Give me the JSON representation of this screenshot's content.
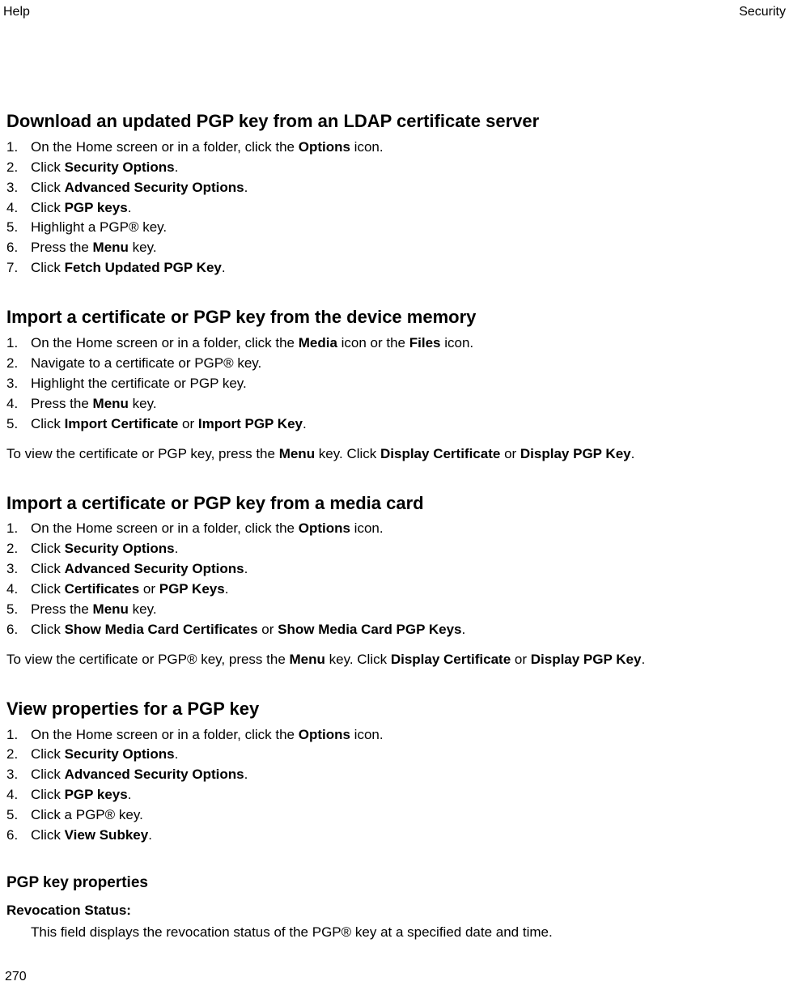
{
  "header": {
    "left": "Help",
    "right": "Security"
  },
  "pageNumber": "270",
  "sections": [
    {
      "heading": "Download an updated PGP key from an LDAP certificate server",
      "steps": [
        [
          {
            "t": "On the Home screen or in a folder, click the "
          },
          {
            "t": "Options",
            "b": true
          },
          {
            "t": " icon."
          }
        ],
        [
          {
            "t": "Click "
          },
          {
            "t": "Security Options",
            "b": true
          },
          {
            "t": "."
          }
        ],
        [
          {
            "t": "Click "
          },
          {
            "t": "Advanced Security Options",
            "b": true
          },
          {
            "t": "."
          }
        ],
        [
          {
            "t": "Click "
          },
          {
            "t": "PGP keys",
            "b": true
          },
          {
            "t": "."
          }
        ],
        [
          {
            "t": "Highlight a PGP® key."
          }
        ],
        [
          {
            "t": "Press the "
          },
          {
            "t": "Menu",
            "b": true
          },
          {
            "t": " key."
          }
        ],
        [
          {
            "t": "Click "
          },
          {
            "t": "Fetch Updated PGP Key",
            "b": true
          },
          {
            "t": "."
          }
        ]
      ]
    },
    {
      "heading": "Import a certificate or PGP key from the device memory",
      "steps": [
        [
          {
            "t": "On the Home screen or in a folder, click the "
          },
          {
            "t": "Media",
            "b": true
          },
          {
            "t": " icon or the "
          },
          {
            "t": "Files",
            "b": true
          },
          {
            "t": " icon."
          }
        ],
        [
          {
            "t": "Navigate to a certificate or PGP® key."
          }
        ],
        [
          {
            "t": "Highlight the certificate or PGP key."
          }
        ],
        [
          {
            "t": "Press the "
          },
          {
            "t": "Menu",
            "b": true
          },
          {
            "t": " key."
          }
        ],
        [
          {
            "t": "Click "
          },
          {
            "t": "Import Certificate",
            "b": true
          },
          {
            "t": " or "
          },
          {
            "t": "Import PGP Key",
            "b": true
          },
          {
            "t": "."
          }
        ]
      ],
      "note": [
        {
          "t": "To view the certificate or PGP key, press the "
        },
        {
          "t": "Menu",
          "b": true
        },
        {
          "t": " key. Click "
        },
        {
          "t": "Display Certificate",
          "b": true
        },
        {
          "t": " or "
        },
        {
          "t": "Display PGP Key",
          "b": true
        },
        {
          "t": "."
        }
      ]
    },
    {
      "heading": "Import a certificate or PGP key from a media card",
      "steps": [
        [
          {
            "t": "On the Home screen or in a folder, click the "
          },
          {
            "t": "Options",
            "b": true
          },
          {
            "t": " icon."
          }
        ],
        [
          {
            "t": "Click "
          },
          {
            "t": "Security Options",
            "b": true
          },
          {
            "t": "."
          }
        ],
        [
          {
            "t": "Click "
          },
          {
            "t": "Advanced Security Options",
            "b": true
          },
          {
            "t": "."
          }
        ],
        [
          {
            "t": "Click "
          },
          {
            "t": "Certificates",
            "b": true
          },
          {
            "t": " or "
          },
          {
            "t": "PGP Keys",
            "b": true
          },
          {
            "t": "."
          }
        ],
        [
          {
            "t": "Press the "
          },
          {
            "t": "Menu",
            "b": true
          },
          {
            "t": " key."
          }
        ],
        [
          {
            "t": "Click "
          },
          {
            "t": "Show Media Card Certificates",
            "b": true
          },
          {
            "t": " or "
          },
          {
            "t": "Show Media Card PGP Keys",
            "b": true
          },
          {
            "t": "."
          }
        ]
      ],
      "note": [
        {
          "t": "To view the certificate or PGP® key, press the "
        },
        {
          "t": "Menu",
          "b": true
        },
        {
          "t": " key. Click "
        },
        {
          "t": "Display Certificate",
          "b": true
        },
        {
          "t": " or "
        },
        {
          "t": "Display PGP Key",
          "b": true
        },
        {
          "t": "."
        }
      ]
    },
    {
      "heading": "View properties for a PGP key",
      "steps": [
        [
          {
            "t": "On the Home screen or in a folder, click the "
          },
          {
            "t": "Options",
            "b": true
          },
          {
            "t": " icon."
          }
        ],
        [
          {
            "t": "Click "
          },
          {
            "t": "Security Options",
            "b": true
          },
          {
            "t": "."
          }
        ],
        [
          {
            "t": "Click "
          },
          {
            "t": "Advanced Security Options",
            "b": true
          },
          {
            "t": "."
          }
        ],
        [
          {
            "t": "Click "
          },
          {
            "t": "PGP keys",
            "b": true
          },
          {
            "t": "."
          }
        ],
        [
          {
            "t": "Click a PGP® key."
          }
        ],
        [
          {
            "t": "Click "
          },
          {
            "t": "View Subkey",
            "b": true
          },
          {
            "t": "."
          }
        ]
      ]
    }
  ],
  "properties": {
    "heading": "PGP key properties",
    "items": [
      {
        "term": "Revocation Status:",
        "def": "This field displays the revocation status of the PGP® key at a specified date and time."
      }
    ]
  }
}
